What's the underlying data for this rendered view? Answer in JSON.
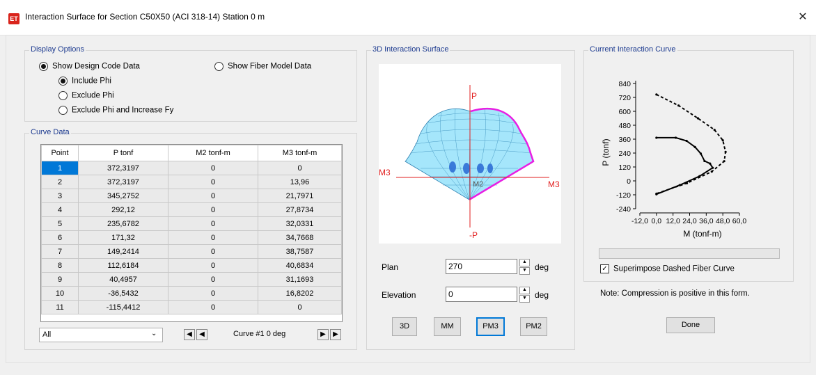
{
  "window": {
    "icon_text": "ET",
    "title": "Interaction Surface for Section C50X50 (ACI 318-14)  Station 0 m",
    "close_glyph": "✕"
  },
  "display_options": {
    "label": "Display Options",
    "show_design_code": "Show Design Code Data",
    "include_phi": "Include Phi",
    "exclude_phi": "Exclude Phi",
    "exclude_phi_increase_fy": "Exclude Phi and Increase Fy",
    "show_fiber_model": "Show Fiber Model Data"
  },
  "curve_data": {
    "label": "Curve Data",
    "columns": [
      "Point",
      "P tonf",
      "M2 tonf-m",
      "M3 tonf-m"
    ],
    "rows": [
      [
        "1",
        "372,3197",
        "0",
        "0"
      ],
      [
        "2",
        "372,3197",
        "0",
        "13,96"
      ],
      [
        "3",
        "345,2752",
        "0",
        "21,7971"
      ],
      [
        "4",
        "292,12",
        "0",
        "27,8734"
      ],
      [
        "5",
        "235,6782",
        "0",
        "32,0331"
      ],
      [
        "6",
        "171,32",
        "0",
        "34,7668"
      ],
      [
        "7",
        "149,2414",
        "0",
        "38,7587"
      ],
      [
        "8",
        "112,6184",
        "0",
        "40,6834"
      ],
      [
        "9",
        "40,4957",
        "0",
        "31,1693"
      ],
      [
        "10",
        "-36,5432",
        "0",
        "16,8202"
      ],
      [
        "11",
        "-115,4412",
        "0",
        "0"
      ]
    ],
    "filter_value": "All",
    "curve_label": "Curve #1  0 deg"
  },
  "surface": {
    "label": "3D Interaction Surface",
    "axis_p": "P",
    "axis_neg_p": "-P",
    "axis_m3_left": "M3",
    "axis_m3_right": "M3",
    "axis_m2": "M2",
    "plan_label": "Plan",
    "plan_value": "270",
    "elevation_label": "Elevation",
    "elevation_value": "0",
    "deg": "deg",
    "buttons": [
      "3D",
      "MM",
      "PM3",
      "PM2"
    ]
  },
  "current_curve": {
    "label": "Current Interaction Curve",
    "superimpose": "Superimpose Dashed Fiber Curve",
    "note": "Note:  Compression is positive in this form.",
    "done": "Done"
  },
  "chart_data": {
    "type": "line",
    "xlabel": "M (tonf-m)",
    "ylabel": "P (tonf)",
    "xlim": [
      -12,
      60
    ],
    "ylim": [
      -240,
      840
    ],
    "x_ticks": [
      "-12,0",
      "0,0",
      "12,0",
      "24,0",
      "36,0",
      "48,0",
      "60,0"
    ],
    "y_ticks": [
      "840",
      "720",
      "600",
      "480",
      "360",
      "240",
      "120",
      "0",
      "-120",
      "-240"
    ],
    "series": [
      {
        "style": "solid",
        "x": [
          0,
          13.96,
          21.7971,
          27.8734,
          32.0331,
          34.7668,
          38.7587,
          40.6834,
          31.1693,
          16.8202,
          0
        ],
        "y": [
          372.3197,
          372.3197,
          345.2752,
          292.12,
          235.6782,
          171.32,
          149.2414,
          112.6184,
          40.4957,
          -36.5432,
          -115.4412
        ]
      },
      {
        "style": "dashed",
        "x": [
          0,
          16,
          30,
          42,
          48,
          50,
          49,
          40,
          22,
          0
        ],
        "y": [
          745,
          650,
          540,
          440,
          350,
          250,
          170,
          80,
          -20,
          -110
        ]
      }
    ]
  }
}
